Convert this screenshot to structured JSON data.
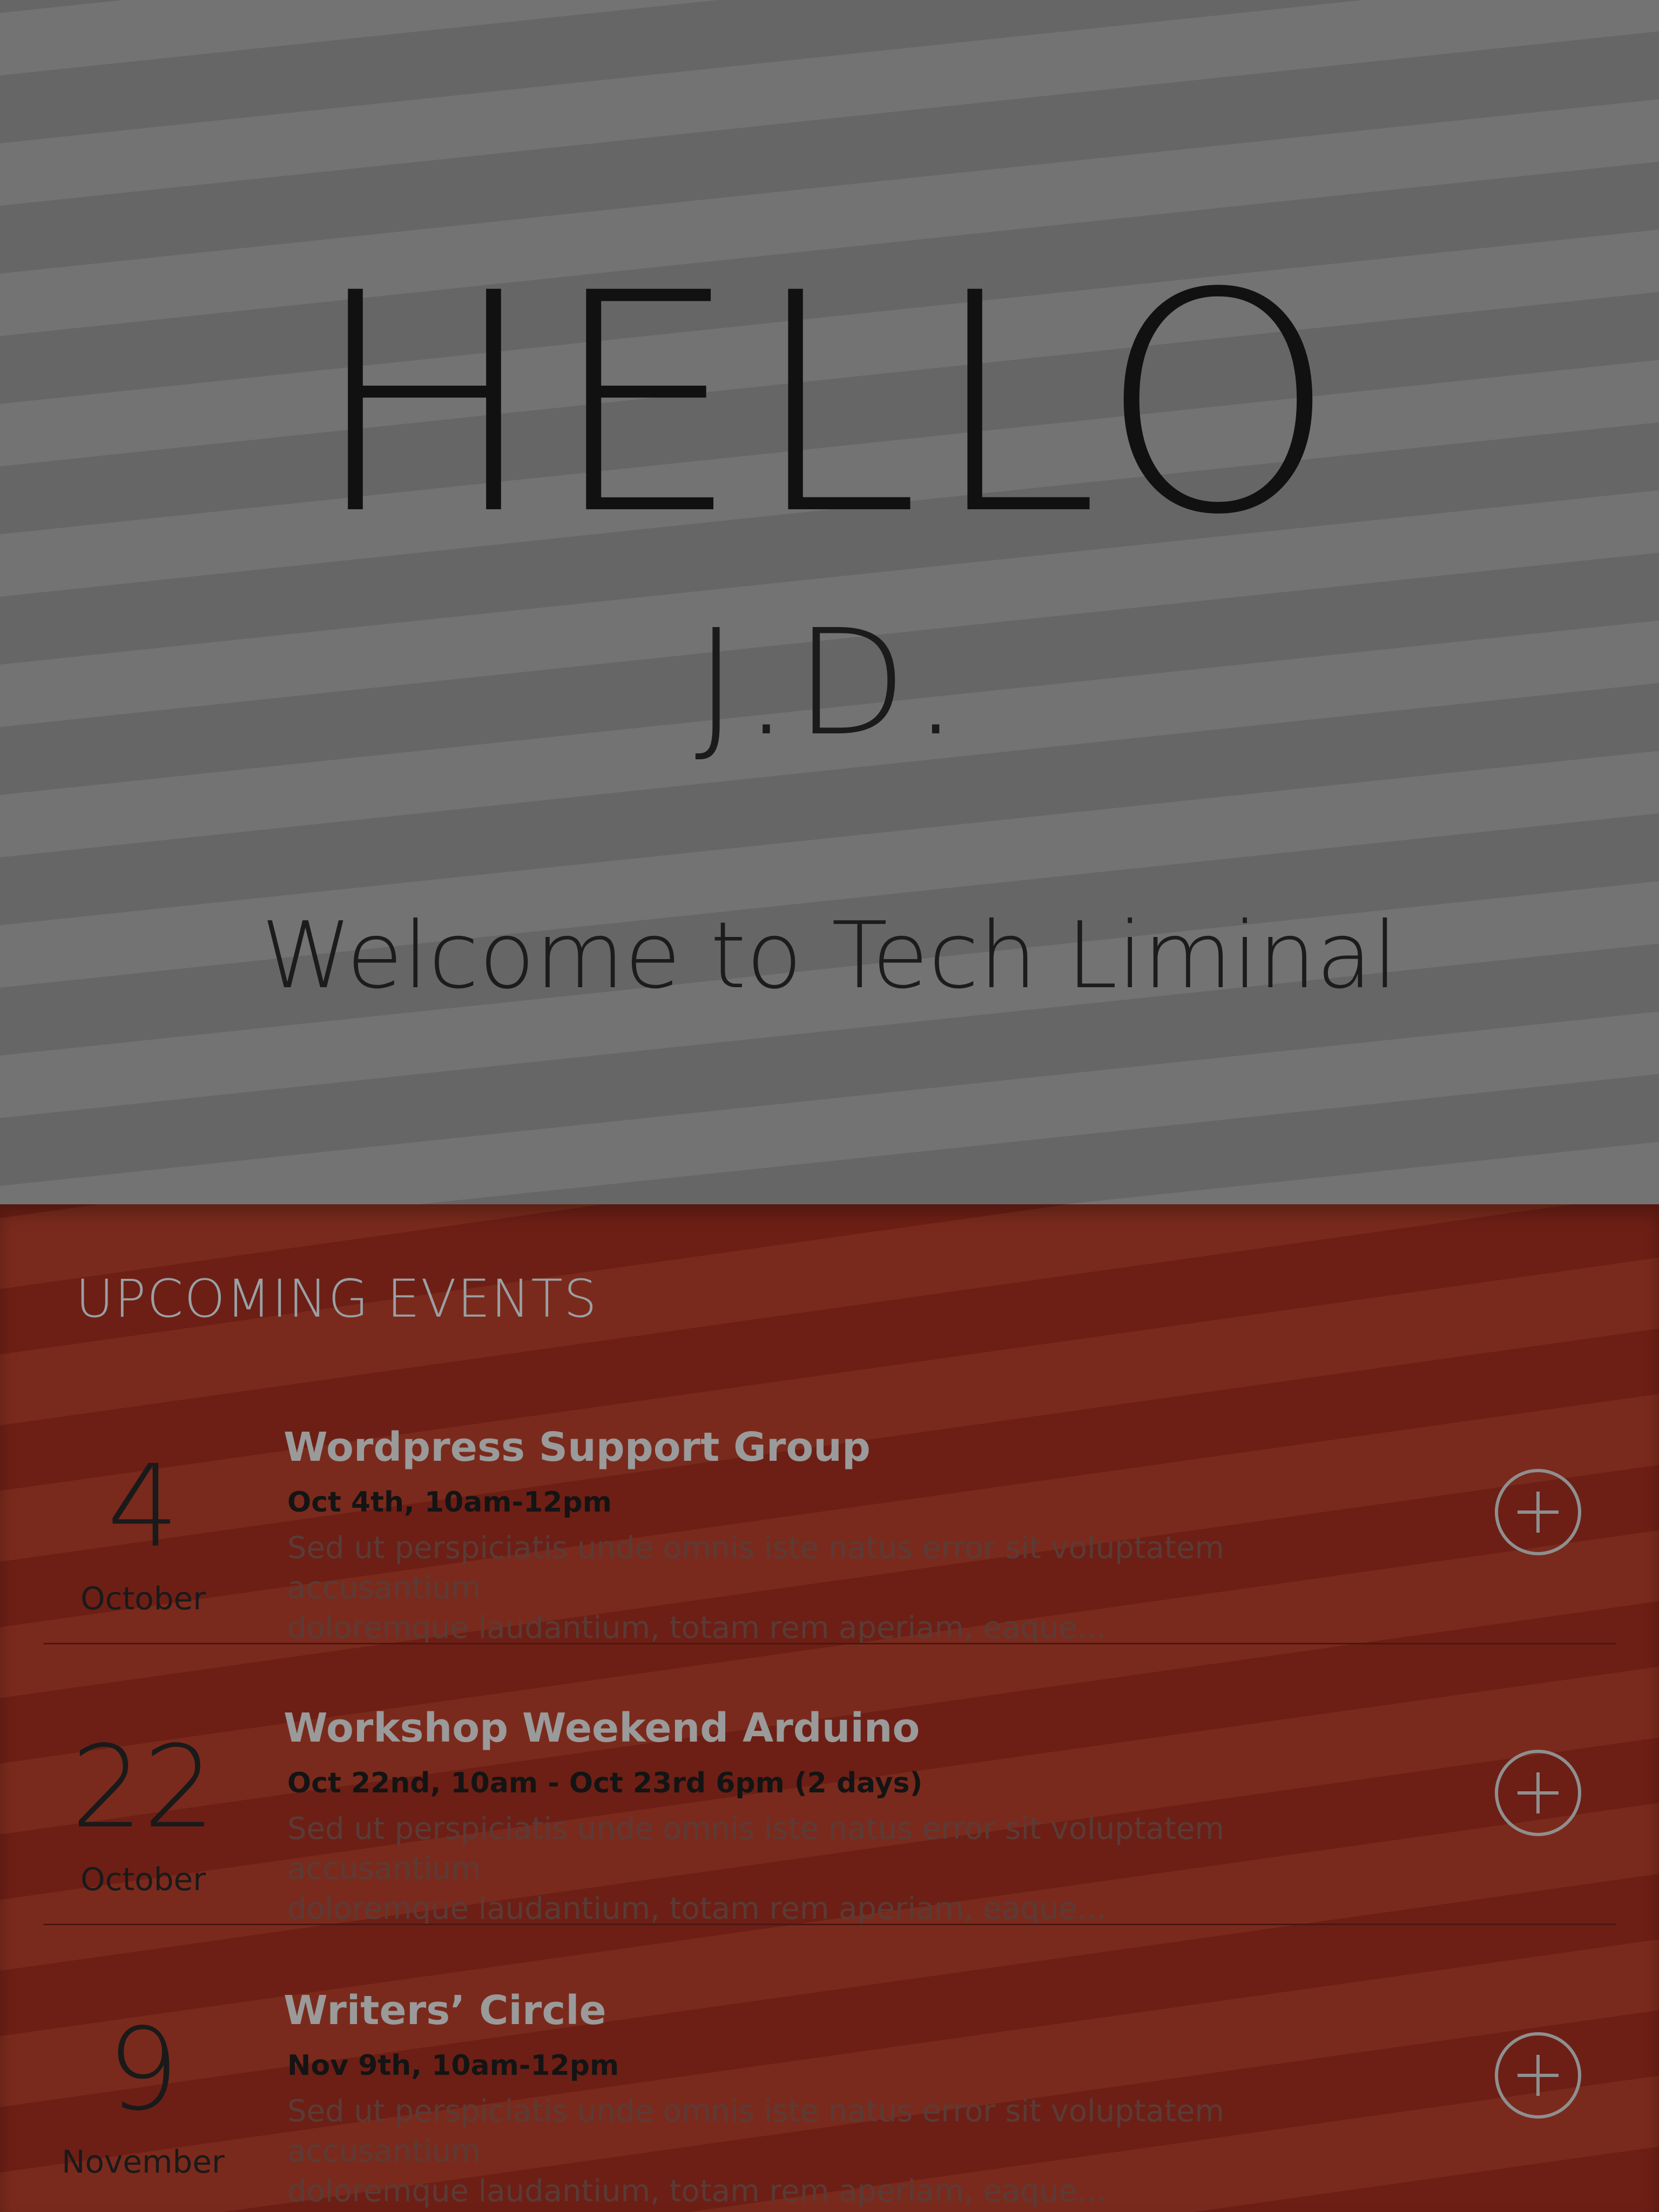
{
  "hero": {
    "greeting": "HELLO",
    "name": "J.D.",
    "welcome": "Welcome to Tech Liminal"
  },
  "events": {
    "heading": "UPCOMING EVENTS",
    "items": [
      {
        "day": "4",
        "month": "October",
        "title": "Wordpress Support Group",
        "when": "Oct 4th, 10am-12pm",
        "desc_line1": "Sed ut perspiciatis unde omnis iste natus error sit voluptatem accusantium",
        "desc_line2": "doloremque laudantium, totam rem aperiam, eaque...",
        "action_icon": "plus-circle-icon"
      },
      {
        "day": "22",
        "month": "October",
        "title": "Workshop Weekend Arduino",
        "when": "Oct 22nd, 10am - Oct 23rd 6pm (2 days)",
        "desc_line1": "Sed ut perspiciatis unde omnis iste natus error sit voluptatem accusantium",
        "desc_line2": "doloremque laudantium, totam rem aperiam, eaque...",
        "action_icon": "plus-circle-icon"
      },
      {
        "day": "9",
        "month": "November",
        "title": "Writers’ Circle",
        "when": "Nov 9th, 10am-12pm",
        "desc_line1": "Sed ut perspiciatis unde omnis iste natus error sit voluptatem accusantium",
        "desc_line2": "doloremque laudantium, totam rem aperiam, eaque...",
        "action_icon": "plus-circle-icon"
      }
    ]
  },
  "colors": {
    "hero_stripe_light": "#737373",
    "hero_stripe_dark": "#666666",
    "events_stripe_light": "#7a2a1c",
    "events_stripe_dark": "#6d1f15",
    "event_title": "#9a9a9a",
    "heading": "#9aa0a4"
  }
}
